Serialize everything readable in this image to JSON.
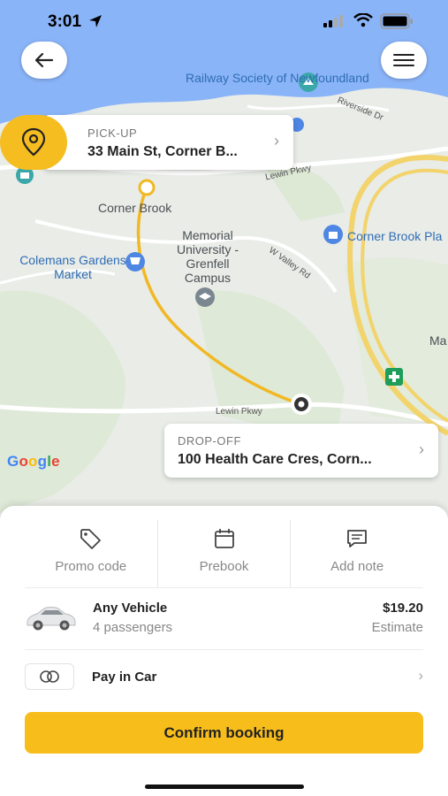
{
  "status_bar": {
    "time": "3:01"
  },
  "map": {
    "labels": {
      "railway": "Railway Society of Newfoundland",
      "corner_brook": "Corner Brook",
      "memorial": "Memorial University - Grenfell Campus",
      "colemans": "Colemans Gardens Market",
      "corner_brook_plaza": "Corner Brook Pla",
      "ma": "Ma",
      "riverside": "Riverside Dr",
      "lewin_pkwy_top": "Lewin Pkwy",
      "w_valley": "W Valley Rd",
      "lewin_pkwy_bottom": "Lewin Pkwy",
      "google": "Google"
    },
    "google_colors": [
      "#4285F4",
      "#EA4335",
      "#FBBC05",
      "#4285F4",
      "#34A853",
      "#EA4335"
    ]
  },
  "pickup": {
    "caption": "PICK-UP",
    "address": "33 Main St, Corner B..."
  },
  "dropoff": {
    "caption": "DROP-OFF",
    "address": "100 Health Care Cres, Corn..."
  },
  "actions": [
    {
      "label": "Promo code",
      "icon": "tag-icon"
    },
    {
      "label": "Prebook",
      "icon": "calendar-icon"
    },
    {
      "label": "Add note",
      "icon": "note-icon"
    }
  ],
  "vehicle": {
    "name": "Any Vehicle",
    "passengers": "4 passengers",
    "price": "$19.20",
    "price_note": "Estimate"
  },
  "payment": {
    "label": "Pay in Car"
  },
  "confirm_label": "Confirm booking",
  "colors": {
    "accent": "#F5BD1F",
    "route": "#F2B824",
    "water": "#8AB4F8"
  }
}
